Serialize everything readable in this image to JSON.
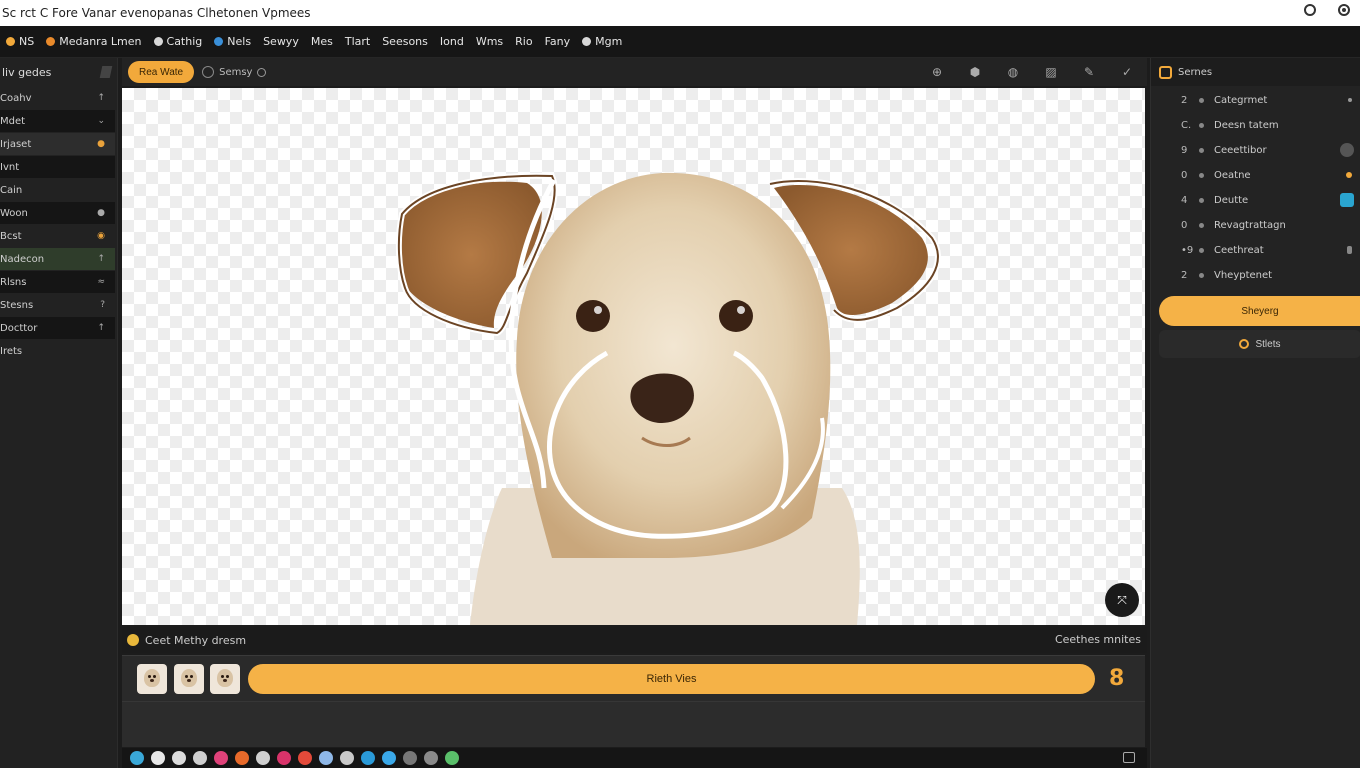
{
  "window": {
    "title": "Sc rct C Fore Vanar evenopanas Clhetonen Vpmees"
  },
  "menubar": {
    "items": [
      {
        "label": "NS",
        "icon": "app-icon",
        "color": "#f2a93b"
      },
      {
        "label": "Medanra Lmen",
        "icon": "gear-icon",
        "color": "#e98a2b"
      },
      {
        "label": "Cathig",
        "icon": "user-icon",
        "color": "#d8d8d8"
      },
      {
        "label": "Nels",
        "icon": "info-icon",
        "color": "#3a8fd8"
      },
      {
        "label": "Sewyy",
        "icon": "",
        "color": ""
      },
      {
        "label": "Mes",
        "icon": "",
        "color": ""
      },
      {
        "label": "Tlart",
        "icon": "",
        "color": ""
      },
      {
        "label": "Seesons",
        "icon": "",
        "color": ""
      },
      {
        "label": "Iond",
        "icon": "",
        "color": ""
      },
      {
        "label": "Wms",
        "icon": "",
        "color": ""
      },
      {
        "label": "Rio",
        "icon": "",
        "color": ""
      },
      {
        "label": "Fany",
        "icon": "",
        "color": ""
      },
      {
        "label": "Mgm",
        "icon": "globe-icon",
        "color": "#d8d8d8"
      }
    ]
  },
  "sidebar": {
    "title": "liv gedes",
    "items": [
      {
        "label": "Coahv",
        "indicator": "↑",
        "style": "",
        "indicator_style": ""
      },
      {
        "label": "Mdet",
        "indicator": "⌄",
        "style": "dark",
        "indicator_style": ""
      },
      {
        "label": "Irjaset",
        "indicator": "●",
        "style": "sel",
        "indicator_style": "orange"
      },
      {
        "label": "Ivnt",
        "indicator": "",
        "style": "dark",
        "indicator_style": ""
      },
      {
        "label": "Cain",
        "indicator": "",
        "style": "",
        "indicator_style": ""
      },
      {
        "label": "Woon",
        "indicator": "●",
        "style": "dark",
        "indicator_style": ""
      },
      {
        "label": "Bcst",
        "indicator": "◉",
        "style": "",
        "indicator_style": "orange"
      },
      {
        "label": "Nadecon",
        "indicator": "↑",
        "style": "green",
        "indicator_style": ""
      },
      {
        "label": "Rlsns",
        "indicator": "≈",
        "style": "dark",
        "indicator_style": ""
      },
      {
        "label": "Stesns",
        "indicator": "?",
        "style": "",
        "indicator_style": ""
      },
      {
        "label": "Docttor",
        "indicator": "↑",
        "style": "dark",
        "indicator_style": ""
      },
      {
        "label": "Irets",
        "indicator": "",
        "style": "",
        "indicator_style": ""
      }
    ]
  },
  "toolbar": {
    "primary_label": "Rea Wate",
    "secondary_label": "Semsy",
    "tools": [
      {
        "name": "zoom-icon",
        "glyph": "⊕"
      },
      {
        "name": "shape-icon",
        "glyph": "⬢"
      },
      {
        "name": "mask-icon",
        "glyph": "◍"
      },
      {
        "name": "image-icon",
        "glyph": "▨"
      },
      {
        "name": "brush-icon",
        "glyph": "✎"
      },
      {
        "name": "check-icon",
        "glyph": "✓"
      }
    ]
  },
  "canvas": {
    "fab_label": "⤧"
  },
  "status": {
    "left": "Ceet Methy dresm",
    "right": "Ceethes mnites"
  },
  "filmstrip": {
    "button_label": "Rieth Vies",
    "badge": "8"
  },
  "dock": {
    "icons": [
      {
        "name": "app-icon",
        "color": "#3aa8d8"
      },
      {
        "name": "circle-icon",
        "color": "#e8e8e8"
      },
      {
        "name": "target-icon",
        "color": "#dcdcdc"
      },
      {
        "name": "cloud-icon",
        "color": "#cfcfcf"
      },
      {
        "name": "heart-icon",
        "color": "#e0427a"
      },
      {
        "name": "star-icon",
        "color": "#e86a2a"
      },
      {
        "name": "brush-icon",
        "color": "#cfcfcf"
      },
      {
        "name": "gem-icon",
        "color": "#d8336a"
      },
      {
        "name": "shield-icon",
        "color": "#e24a3a"
      },
      {
        "name": "globe-icon",
        "color": "#8fb8e8"
      },
      {
        "name": "pin-icon",
        "color": "#c9c9c9"
      },
      {
        "name": "drop-icon",
        "color": "#2a9ad8"
      },
      {
        "name": "chat-icon",
        "color": "#3aa8e8"
      },
      {
        "name": "refresh-icon",
        "color": "#777777"
      },
      {
        "name": "play-icon",
        "color": "#8a8a8a"
      },
      {
        "name": "chart-icon",
        "color": "#5abf6a"
      }
    ]
  },
  "rpanel": {
    "title": "Sernes",
    "layers": [
      {
        "num": "2",
        "label": "Categrmet",
        "ind": "tiny"
      },
      {
        "num": "C.",
        "label": "Deesn tatem",
        "ind": ""
      },
      {
        "num": "9",
        "label": "Ceeettibor",
        "ind": "grey"
      },
      {
        "num": "0",
        "label": "Oeatne",
        "ind": "orange"
      },
      {
        "num": "4",
        "label": "Deutte",
        "ind": "blue"
      },
      {
        "num": "0",
        "label": "Revagtrattagn",
        "ind": ""
      },
      {
        "num": "•9",
        "label": "Ceethreat",
        "ind": "bar"
      },
      {
        "num": "2",
        "label": "Vheyptenet",
        "ind": ""
      }
    ],
    "primary_label": "Sheyerg",
    "secondary_label": "Stlets"
  }
}
